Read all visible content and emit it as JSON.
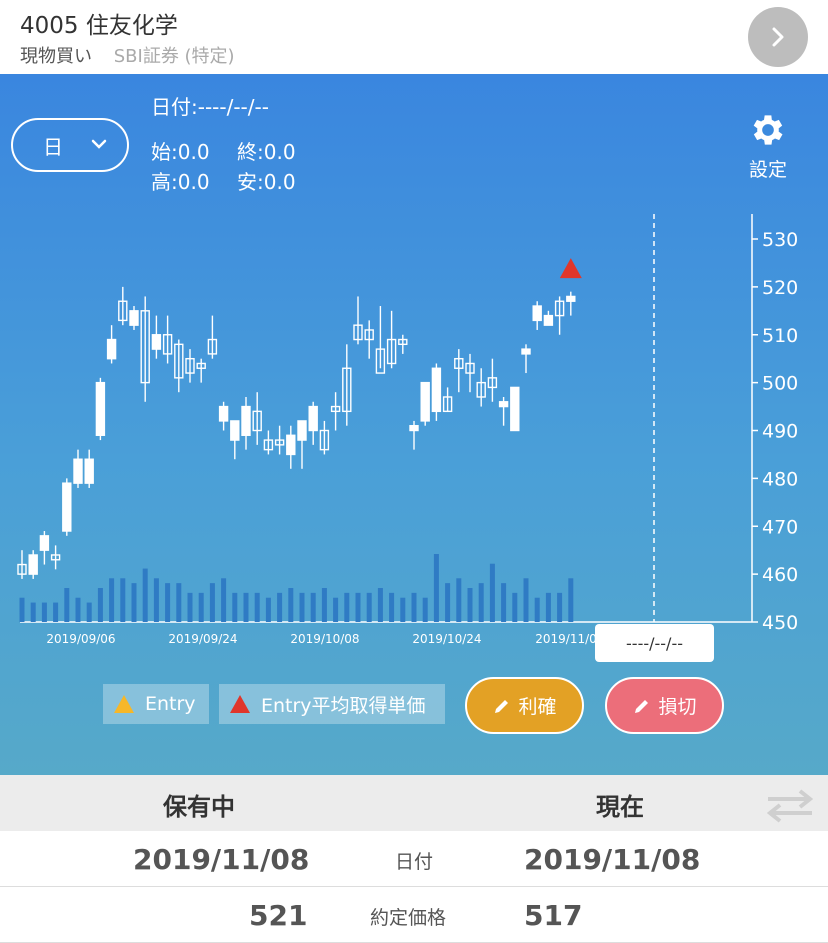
{
  "header": {
    "title": "4005 住友化学",
    "trade_type": "現物買い",
    "broker": "SBI証券 (特定)"
  },
  "chart_panel": {
    "period": "日",
    "date_label": "日付:----/--/--",
    "open_label": "始:0.0",
    "close_label": "終:0.0",
    "high_label": "高:0.0",
    "low_label": "安:0.0",
    "settings_label": "設定",
    "now_date": "----/--/--"
  },
  "legend": {
    "entry": "Entry",
    "entry_avg": "Entry平均取得単価"
  },
  "buttons": {
    "take_profit": "利確",
    "stop_loss": "損切"
  },
  "colors": {
    "entry_marker": "#f6b729",
    "entry_avg_marker": "#e0362b",
    "take_profit": "#e3a125",
    "stop_loss": "#ec6e7a",
    "volume_bar": "#2f7bc4"
  },
  "chart_data": {
    "type": "candlestick",
    "y_ticks": [
      "530",
      "520",
      "510",
      "500",
      "490",
      "480",
      "470",
      "460",
      "450"
    ],
    "ylim": [
      450,
      535
    ],
    "x_ticks": [
      "2019/09/06",
      "2019/09/24",
      "2019/10/08",
      "2019/10/24",
      "2019/11/0"
    ],
    "candles": [
      [
        462,
        465,
        459,
        460
      ],
      [
        460,
        465,
        459,
        464
      ],
      [
        465,
        469,
        462,
        468
      ],
      [
        464,
        466,
        461,
        463
      ],
      [
        469,
        480,
        468,
        479
      ],
      [
        479,
        486,
        478,
        484
      ],
      [
        479,
        486,
        478,
        484
      ],
      [
        489,
        501,
        488,
        500
      ],
      [
        505,
        512,
        504,
        509
      ],
      [
        517,
        520,
        512,
        513
      ],
      [
        512,
        516,
        511,
        515
      ],
      [
        515,
        518,
        496,
        500
      ],
      [
        507,
        514,
        505,
        510
      ],
      [
        510,
        514,
        504,
        506
      ],
      [
        508,
        509,
        498,
        501
      ],
      [
        505,
        507,
        500,
        502
      ],
      [
        504,
        505,
        500,
        503
      ],
      [
        509,
        514,
        505,
        506
      ],
      [
        492,
        496,
        490,
        495
      ],
      [
        488,
        492,
        484,
        492
      ],
      [
        489,
        497,
        486,
        495
      ],
      [
        494,
        498,
        487,
        490
      ],
      [
        488,
        490,
        485,
        486
      ],
      [
        488,
        491,
        485,
        487
      ],
      [
        485,
        491,
        482,
        489
      ],
      [
        488,
        491,
        482,
        492
      ],
      [
        490,
        496,
        487,
        495
      ],
      [
        490,
        492,
        485,
        486
      ],
      [
        495,
        498,
        490,
        494
      ],
      [
        503,
        508,
        491,
        494
      ],
      [
        512,
        518,
        508,
        509
      ],
      [
        511,
        513,
        505,
        509
      ],
      [
        507,
        516,
        503,
        502
      ],
      [
        509,
        515,
        503,
        504
      ],
      [
        509,
        510,
        506,
        508
      ],
      [
        490,
        492,
        486,
        491
      ],
      [
        492,
        500,
        491,
        500
      ],
      [
        494,
        504,
        492,
        503
      ],
      [
        497,
        499,
        494,
        494
      ],
      [
        505,
        507,
        498,
        503
      ],
      [
        504,
        506,
        498,
        502
      ],
      [
        500,
        503,
        495,
        497
      ],
      [
        501,
        505,
        496,
        499
      ],
      [
        495,
        497,
        491,
        496
      ],
      [
        490,
        498,
        493,
        499
      ],
      [
        506,
        508,
        502,
        507
      ],
      [
        513,
        517,
        511,
        516
      ],
      [
        512,
        515,
        513,
        514
      ],
      [
        517,
        518,
        510,
        514
      ],
      [
        517,
        519,
        514,
        518
      ]
    ],
    "volume": [
      5,
      4,
      4,
      4,
      7,
      5,
      4,
      7,
      9,
      9,
      8,
      11,
      9,
      8,
      8,
      6,
      6,
      8,
      9,
      6,
      6,
      6,
      5,
      6,
      7,
      6,
      6,
      7,
      5,
      6,
      6,
      6,
      7,
      6,
      5,
      6,
      5,
      14,
      8,
      9,
      7,
      8,
      12,
      8,
      6,
      9,
      5,
      6,
      6,
      9
    ],
    "entry_marker_value": 521
  },
  "table": {
    "col_held": "保有中",
    "col_current": "現在",
    "rows": [
      {
        "label": "日付",
        "held": "2019/11/08",
        "current": "2019/11/08"
      },
      {
        "label": "約定価格",
        "held": "521",
        "current": "517"
      }
    ]
  }
}
